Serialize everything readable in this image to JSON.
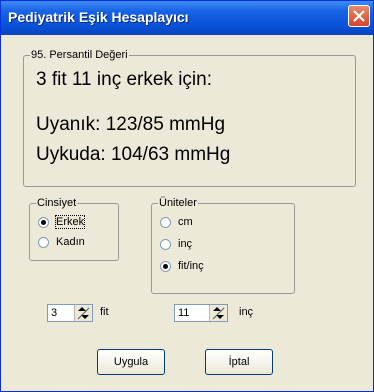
{
  "window": {
    "title": "Pediyatrik Eşik Hesaplayıcı"
  },
  "percentile": {
    "legend": "95. Persantil Değeri",
    "heading": "3 fit 11 inç erkek için:",
    "awake": "Uyanık: 123/85 mmHg",
    "asleep": "Uykuda: 104/63 mmHg"
  },
  "gender": {
    "legend": "Cinsiyet",
    "options": [
      {
        "label": "Erkek",
        "checked": true
      },
      {
        "label": "Kadın",
        "checked": false
      }
    ]
  },
  "units": {
    "legend": "Üniteler",
    "options": [
      {
        "label": "cm",
        "checked": false
      },
      {
        "label": "inç",
        "checked": false
      },
      {
        "label": "fit/inç",
        "checked": true
      }
    ]
  },
  "height": {
    "feet_value": "3",
    "feet_label": "fit",
    "inch_value": "11",
    "inch_label": "inç"
  },
  "buttons": {
    "apply": "Uygula",
    "cancel": "İptal"
  }
}
